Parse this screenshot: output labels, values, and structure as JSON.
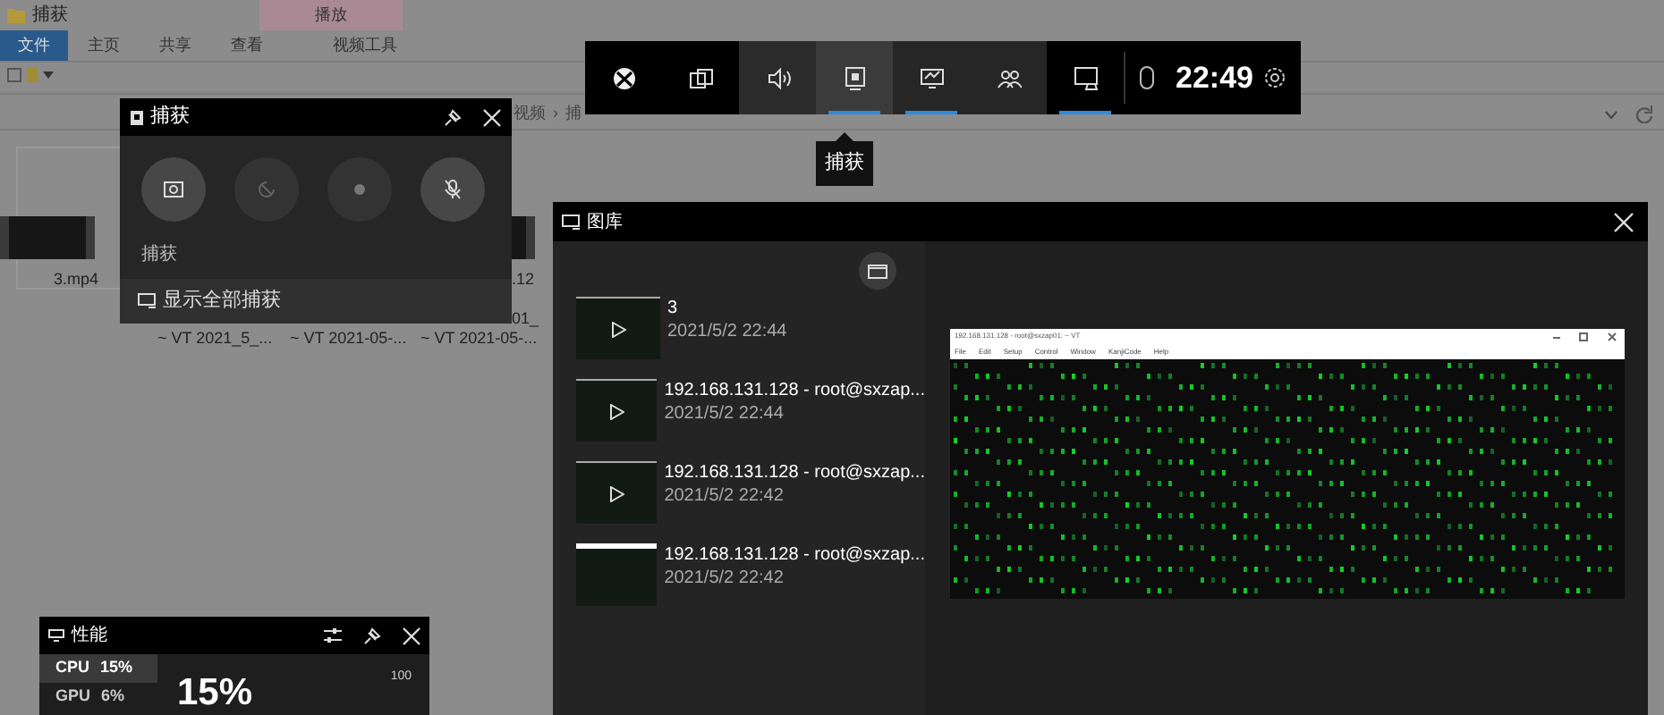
{
  "explorer": {
    "title": "捕获",
    "context_tab": "播放",
    "ribbon_tabs": [
      {
        "label": "文件",
        "selected": true
      },
      {
        "label": "主页",
        "selected": false
      },
      {
        "label": "共享",
        "selected": false
      },
      {
        "label": "查看",
        "selected": false
      },
      {
        "label": "视频工具",
        "selected": false
      }
    ],
    "breadcrumb": [
      "视频",
      "›",
      "捕"
    ],
    "file_labels": [
      "3.mp4",
      ".12",
      "01_",
      "~ VT 2021_5_...",
      "~ VT 2021-05-...",
      "~ VT 2021-05-..."
    ]
  },
  "game_bar": {
    "widgets": [
      {
        "kind": "xbox",
        "active": false
      },
      {
        "kind": "multi",
        "active": false
      },
      {
        "kind": "audio",
        "active": false
      },
      {
        "kind": "capture",
        "active": true
      },
      {
        "kind": "performance",
        "active": true
      },
      {
        "kind": "social",
        "active": false
      },
      {
        "kind": "gallery",
        "active": true
      }
    ],
    "time": "22:49",
    "tooltip": "捕获"
  },
  "capture": {
    "title": "捕获",
    "buttons": [
      {
        "kind": "screenshot",
        "disabled": false
      },
      {
        "kind": "record-last",
        "disabled": true
      },
      {
        "kind": "record",
        "disabled": true
      },
      {
        "kind": "mic",
        "disabled": false
      }
    ],
    "label": "捕获",
    "show_all": "显示全部捕获"
  },
  "gallery": {
    "title": "图库",
    "items": [
      {
        "kind": "video",
        "title": "3",
        "date": "2021/5/2 22:44",
        "selected": false
      },
      {
        "kind": "video",
        "title": "192.168.131.128 - root@sxzap...",
        "date": "2021/5/2 22:44",
        "selected": false
      },
      {
        "kind": "video",
        "title": "192.168.131.128 - root@sxzap...",
        "date": "2021/5/2 22:42",
        "selected": false
      },
      {
        "kind": "image",
        "title": "192.168.131.128 - root@sxzap...",
        "date": "2021/5/2 22:42",
        "selected": true
      }
    ],
    "preview": {
      "title": "192.168.131.128 - root@sxzap01: ~ VT",
      "menu": [
        "File",
        "Edit",
        "Setup",
        "Control",
        "Window",
        "KanjiCode",
        "Help"
      ]
    }
  },
  "performance": {
    "title": "性能",
    "metrics": [
      {
        "label": "CPU",
        "value": "15%",
        "selected": true
      },
      {
        "label": "GPU",
        "value": "6%",
        "selected": false
      }
    ],
    "big_value": "15%",
    "axis_max": "100"
  }
}
